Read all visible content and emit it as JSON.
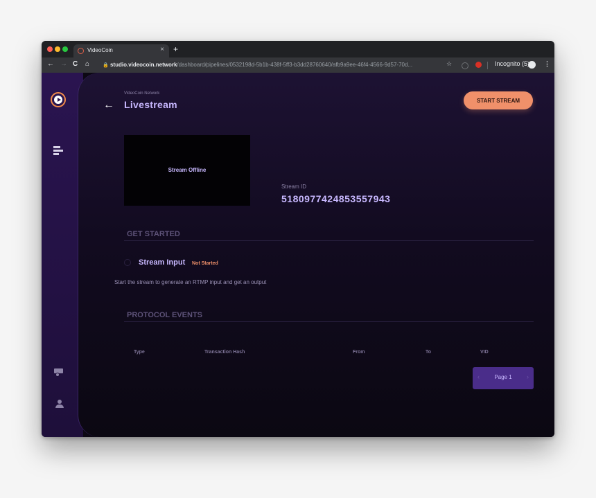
{
  "browser": {
    "tab_title": "VideoCoin",
    "tab_close": "×",
    "new_tab": "+",
    "url_domain": "studio.videocoin.network",
    "url_path": "/dashboard/pipelines/0532198d-5b1b-438f-5ff3-b3dd28760640/afb9a9ee-46f4-4566-9d57-70d...",
    "incognito": "Incognito (5)",
    "nav_back": "←",
    "nav_forward": "→",
    "nav_reload": "C",
    "nav_home": "⌂",
    "lock": "🔒",
    "star": "☆",
    "menu": "⋮"
  },
  "header": {
    "back_arrow": "←",
    "breadcrumb": "VideoCoin Network",
    "title": "Livestream",
    "start_stream": "START STREAM"
  },
  "player": {
    "status": "Stream Offline"
  },
  "stream": {
    "id_label": "Stream ID",
    "id_value": "5180977424853557943"
  },
  "get_started": {
    "heading": "GET STARTED",
    "step_label": "Stream Input",
    "step_status": "Not Started",
    "description": "Start the stream to generate an RTMP input and get an output"
  },
  "protocol": {
    "heading": "PROTOCOL EVENTS",
    "columns": [
      "Type",
      "Transaction Hash",
      "From",
      "To",
      "VID"
    ]
  },
  "pagination": {
    "prev": "‹",
    "label": "Page 1",
    "next": "›"
  },
  "colors": {
    "accent": "#f0906a",
    "title": "#c8b8ff",
    "sidebar": "#2a1450"
  },
  "icons": [
    "videocoin-logo-icon",
    "pipelines-icon",
    "truck-icon",
    "user-icon"
  ]
}
